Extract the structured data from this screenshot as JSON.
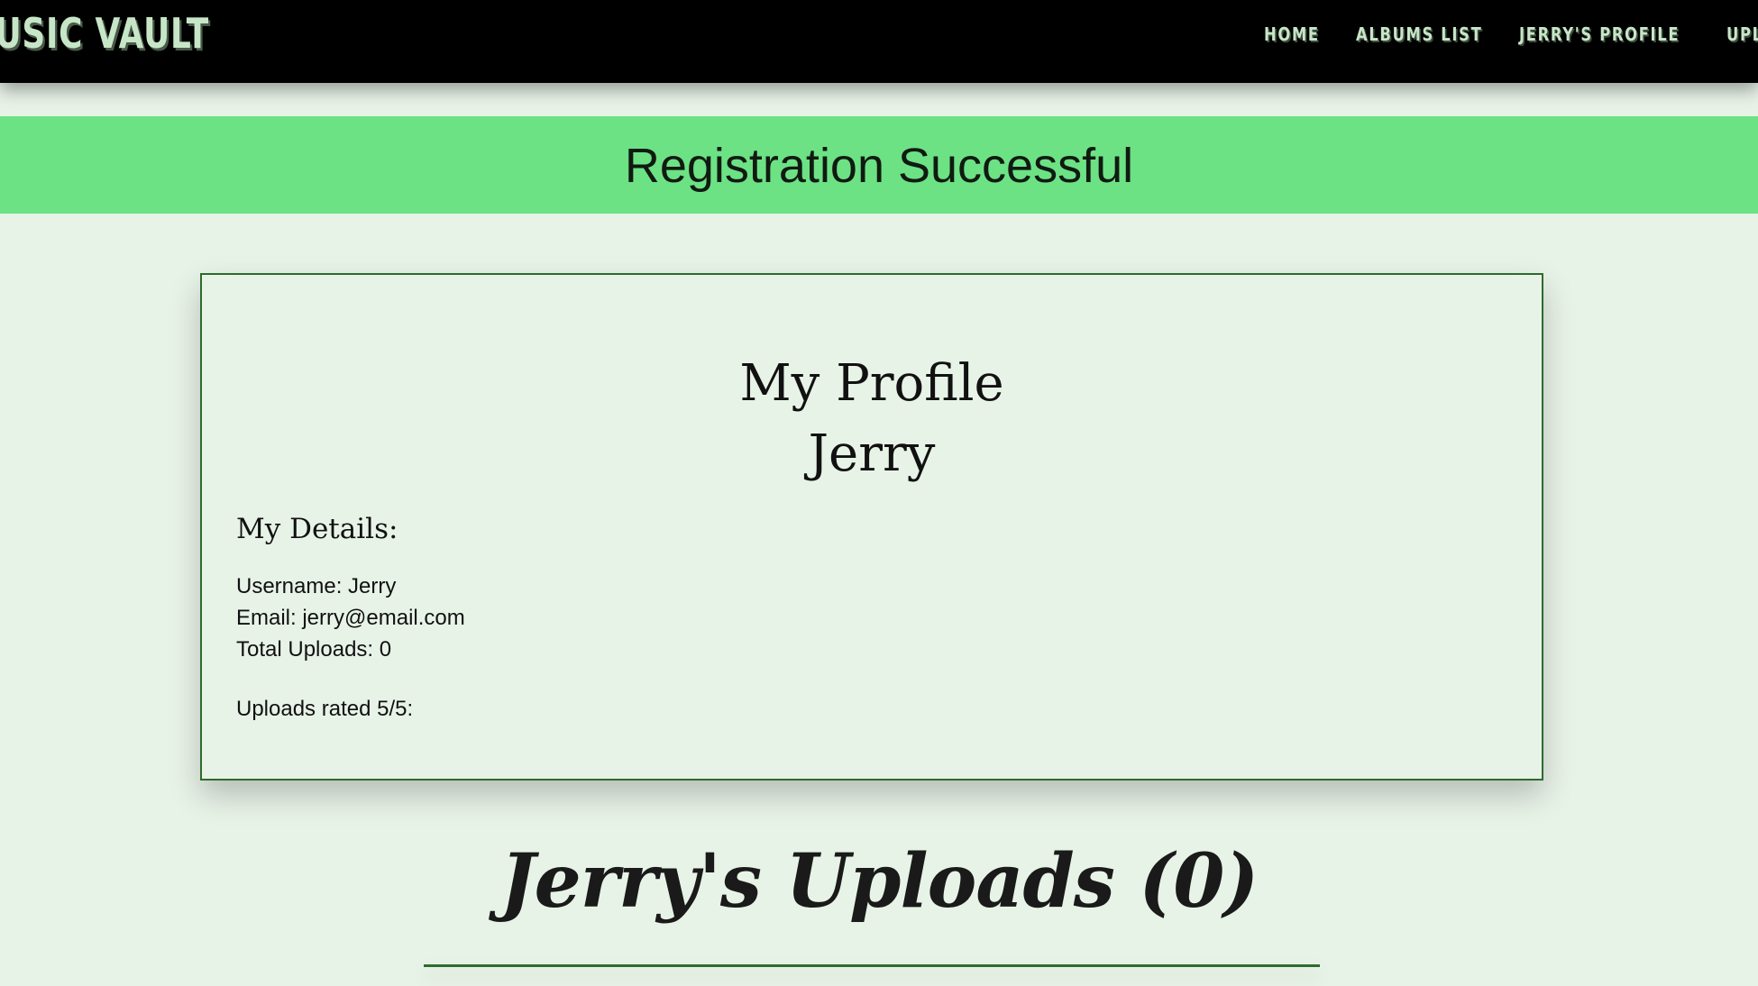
{
  "navbar": {
    "brand": "MUSIC VAULT",
    "links": [
      {
        "label": "HOME"
      },
      {
        "label": "ALBUMS LIST"
      },
      {
        "label": "JERRY'S PROFILE"
      },
      {
        "label": "UPLOAD"
      }
    ]
  },
  "banner": {
    "message": "Registration Successful"
  },
  "profile": {
    "title": "My Profile",
    "name": "Jerry",
    "details_heading": "My Details:",
    "username_line": "Username: Jerry",
    "email_line": "Email: jerry@email.com",
    "total_uploads_line": "Total Uploads: 0",
    "rated_line": "Uploads rated 5/5:"
  },
  "uploads": {
    "heading": "Jerry's Uploads (0)"
  },
  "colors": {
    "navbar_bg": "#000000",
    "nav_text": "#c7e6c7",
    "banner_bg": "#6ce285",
    "page_bg": "#e8f3e8",
    "accent_green": "#2e6b2e"
  }
}
